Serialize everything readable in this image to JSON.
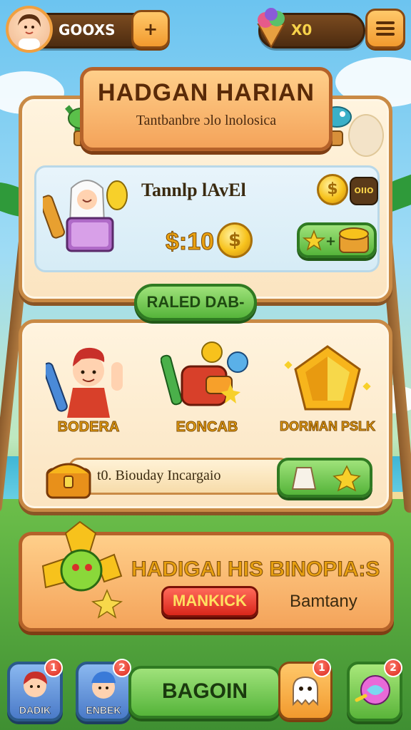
{
  "top_bar": {
    "player_name": "GOOXS",
    "plus_label": "+",
    "currency_value": "X0",
    "menu_icon": "hamburger-icon"
  },
  "daily_mission": {
    "title": "HADGAN HARIAN",
    "subtitle": "Tantbanbre ɔlo lnolosica",
    "task_label": "Tannlp lAvEl",
    "reward_amount": "$:10",
    "coin_badge": "OIIO"
  },
  "rewards_section": {
    "ribbon": "RALED DAB-",
    "items": [
      {
        "label": "BODERA",
        "icon": "hero-boy-icon"
      },
      {
        "label": "EONCAB",
        "icon": "robot-toy-icon"
      },
      {
        "label": "DORMAN PSLK",
        "icon": "gold-gem-icon"
      }
    ],
    "progress_label": "t0. Bioudaу Incargaio"
  },
  "promo": {
    "title": "HADIGAI HIS BINOPIA:S",
    "button_label": "MANKICK",
    "side_text": "Bamtany"
  },
  "bottom_nav": {
    "left_tiles": [
      {
        "label": "DADIK",
        "badge": "1"
      },
      {
        "label": "ENBEK",
        "badge": "2"
      }
    ],
    "main_button": "BAGOIN",
    "right_tiles": [
      {
        "badge": "1"
      },
      {
        "badge": "2"
      }
    ]
  },
  "colors": {
    "panel_border": "#c98a45",
    "banner_fill": "#f4a35a",
    "green_button": "#55b43a",
    "red_button": "#d8261a",
    "gold": "#f7c21c"
  }
}
